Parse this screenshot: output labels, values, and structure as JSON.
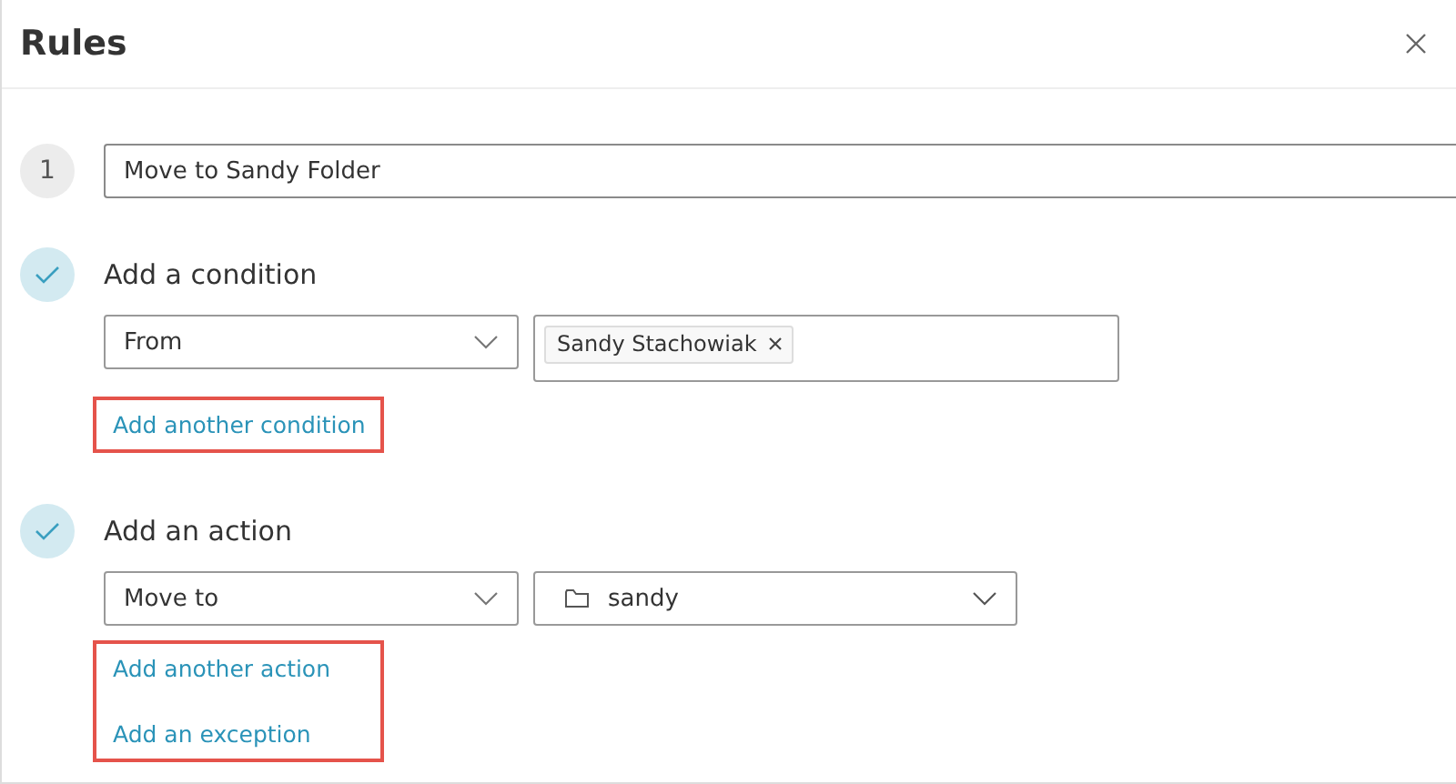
{
  "dialog": {
    "title": "Rules"
  },
  "rule_name": {
    "step": "1",
    "value": "Move to Sandy Folder"
  },
  "sections": [
    {
      "heading": "Add a condition",
      "done": true,
      "field": {
        "value": "From"
      },
      "target": {
        "kind": "tags",
        "tags": [
          "Sandy Stachowiak"
        ]
      },
      "links_highlighted": true,
      "links": [
        "Add another condition"
      ]
    },
    {
      "heading": "Add an action",
      "done": true,
      "field": {
        "value": "Move to"
      },
      "target": {
        "kind": "folder",
        "value": "sandy"
      },
      "links_highlighted": true,
      "links": [
        "Add another action",
        "Add an exception"
      ]
    }
  ]
}
